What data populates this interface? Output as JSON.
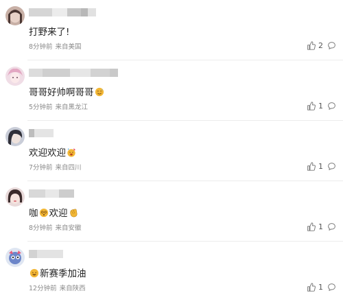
{
  "comments": [
    {
      "text": "打野来了!",
      "time": "8分钟前",
      "location": "来自美国",
      "likes": "2",
      "emoji": "",
      "emoji_pos": ""
    },
    {
      "text": "哥哥好帅啊哥哥",
      "time": "5分钟前",
      "location": "来自黑龙江",
      "likes": "1",
      "emoji": "sweat-smile-emoji",
      "emoji_pos": "after"
    },
    {
      "text": "欢迎欢迎",
      "time": "7分钟前",
      "location": "来自四川",
      "likes": "1",
      "emoji": "party-emoji",
      "emoji_pos": "after"
    },
    {
      "text_a": "咖",
      "text_b": "欢迎",
      "time": "8分钟前",
      "location": "来自安徽",
      "likes": "1"
    },
    {
      "text": "新赛季加油",
      "time": "12分钟前",
      "location": "来自陕西",
      "likes": "1",
      "emoji": "grin-emoji",
      "emoji_pos": "before"
    }
  ],
  "icons": {
    "like": "thumbs-up-icon",
    "reply": "comment-bubble-icon"
  },
  "colors": {
    "meta": "#8a8a8a",
    "emoji": "#f2b736",
    "divider": "#ececec"
  }
}
